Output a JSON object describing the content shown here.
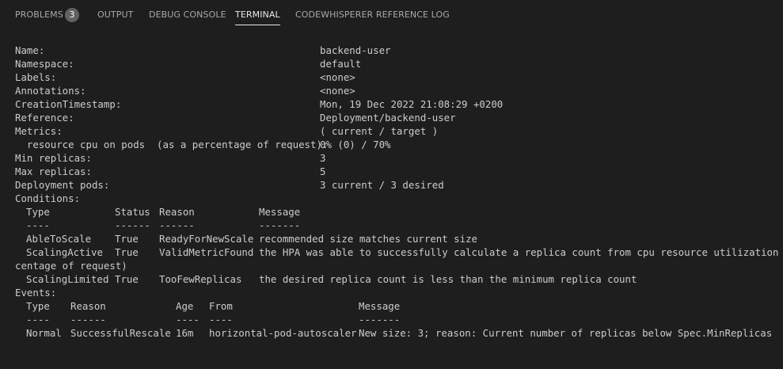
{
  "tabs": {
    "problems": "PROBLEMS",
    "problems_count": "3",
    "output": "OUTPUT",
    "debug_console": "DEBUG CONSOLE",
    "terminal": "TERMINAL",
    "codewhisperer": "CODEWHISPERER REFERENCE LOG"
  },
  "terminal": {
    "name_label": "Name:",
    "name_value": "backend-user",
    "namespace_label": "Namespace:",
    "namespace_value": "default",
    "labels_label": "Labels:",
    "labels_value": "<none>",
    "annotations_label": "Annotations:",
    "annotations_value": "<none>",
    "creation_label": "CreationTimestamp:",
    "creation_value": "Mon, 19 Dec 2022 21:08:29 +0200",
    "reference_label": "Reference:",
    "reference_value": "Deployment/backend-user",
    "metrics_label": "Metrics:",
    "metrics_value": "( current / target )",
    "resource_label": "  resource cpu on pods  (as a percentage of request):",
    "resource_value": "0% (0) / 70%",
    "min_replicas_label": "Min replicas:",
    "min_replicas_value": "3",
    "max_replicas_label": "Max replicas:",
    "max_replicas_value": "5",
    "deployment_pods_label": "Deployment pods:",
    "deployment_pods_value": "3 current / 3 desired",
    "conditions_label": "Conditions:",
    "conditions_headers": [
      "Type",
      "Status",
      "Reason",
      "Message"
    ],
    "conditions_separators": [
      "----",
      "------",
      "------",
      "-------"
    ],
    "conditions": [
      {
        "type": "AbleToScale",
        "status": "True",
        "reason": "ReadyForNewScale",
        "message": "recommended size matches current size"
      },
      {
        "type": "ScalingActive",
        "status": "True",
        "reason": "ValidMetricFound",
        "message": "the HPA was able to successfully calculate a replica count from cpu resource utilization (per"
      },
      {
        "type": "ScalingLimited",
        "status": "True",
        "reason": "TooFewReplicas",
        "message": "the desired replica count is less than the minimum replica count"
      }
    ],
    "wrap_continuation": "centage of request)",
    "events_label": "Events:",
    "events_headers": [
      "Type",
      "Reason",
      "Age",
      "From",
      "Message"
    ],
    "events_separators": [
      "----",
      "------",
      "----",
      "----",
      "-------"
    ],
    "events": [
      {
        "type": "Normal",
        "reason": "SuccessfulRescale",
        "age": "16m",
        "from": "horizontal-pod-autoscaler",
        "message": "New size: 3; reason: Current number of replicas below Spec.MinReplicas"
      }
    ]
  }
}
